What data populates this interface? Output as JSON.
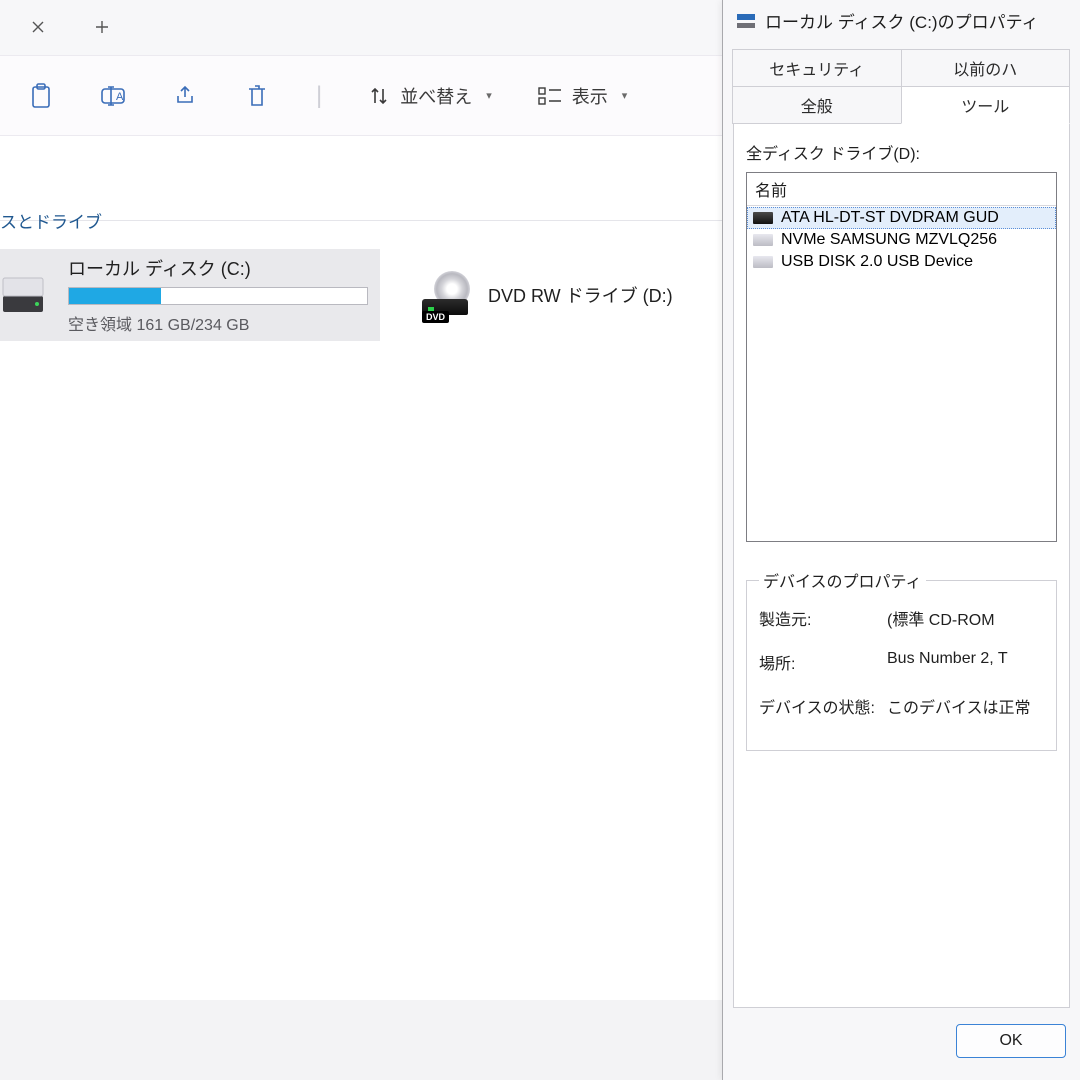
{
  "explorer": {
    "toolbar": {
      "sort_label": "並べ替え",
      "view_label": "表示"
    },
    "content": {
      "section_label": "スとドライブ",
      "drives": [
        {
          "name": "ローカル ディスク (C:)",
          "free_text": "空き領域 161 GB/234 GB"
        },
        {
          "name": "DVD RW ドライブ (D:)"
        }
      ]
    }
  },
  "props": {
    "title": "ローカル ディスク (C:)のプロパティ",
    "tabs_upper": [
      "セキュリティ",
      "以前のハ"
    ],
    "tabs_lower": [
      "全般",
      "ツール"
    ],
    "list_label": "全ディスク ドライブ(D):",
    "list_header": "名前",
    "devices": [
      "ATA HL-DT-ST DVDRAM GUD",
      "NVMe SAMSUNG MZVLQ256",
      "USB DISK 2.0 USB Device"
    ],
    "group_title": "デバイスのプロパティ",
    "rows": {
      "manufacturer_k": "製造元:",
      "manufacturer_v": "(標準 CD-ROM",
      "location_k": "場所:",
      "location_v": "Bus Number 2, T",
      "status_k": "デバイスの状態:",
      "status_v": "このデバイスは正常"
    },
    "ok_label": "OK"
  }
}
